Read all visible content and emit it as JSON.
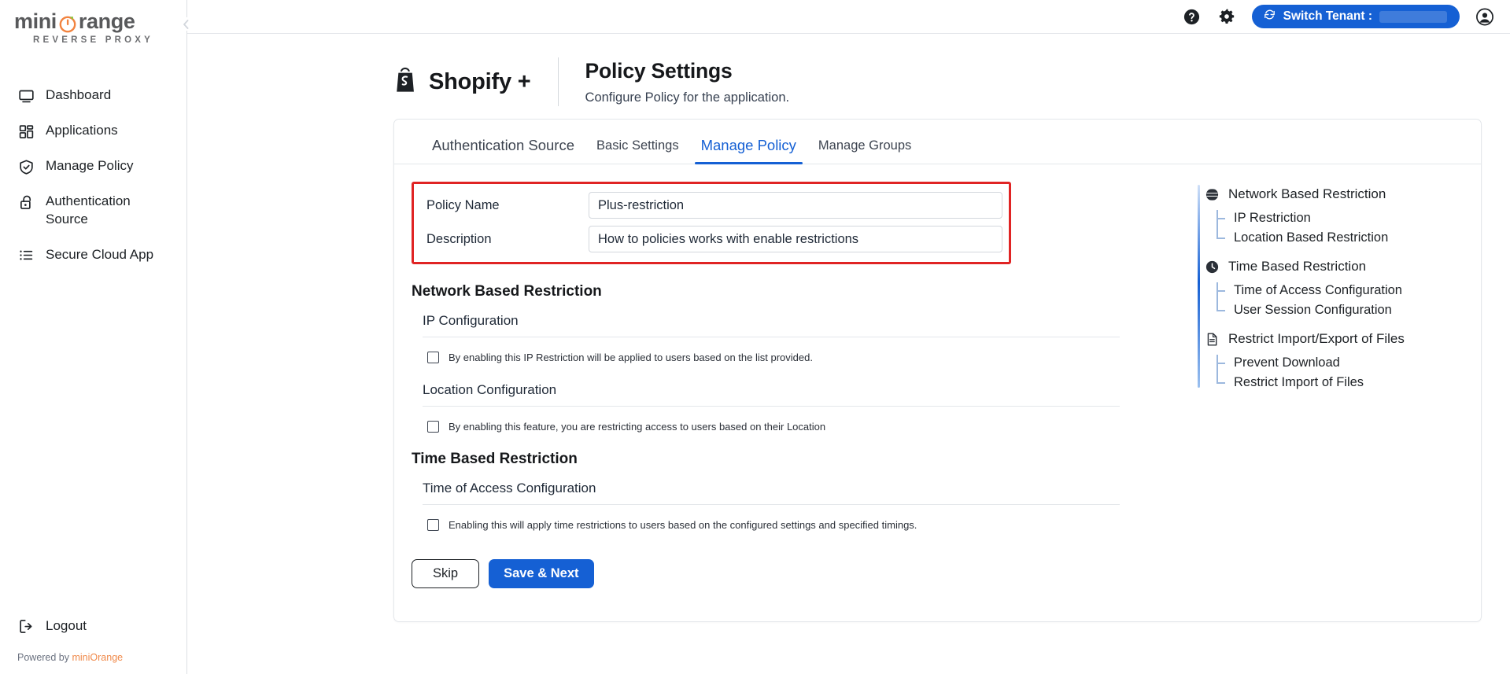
{
  "sidebar": {
    "logo": {
      "text_left": "mini",
      "text_right": "range",
      "subtitle": "REVERSE PROXY"
    },
    "collapse_icon": "chevron-left-icon",
    "items": [
      {
        "label": "Dashboard",
        "icon": "monitor-icon"
      },
      {
        "label": "Applications",
        "icon": "grid-apps-icon"
      },
      {
        "label": "Manage Policy",
        "icon": "shield-check-icon"
      },
      {
        "label": "Authentication Source",
        "icon": "lock-icon"
      },
      {
        "label": "Secure Cloud App",
        "icon": "list-icon"
      }
    ],
    "logout": {
      "label": "Logout",
      "icon": "logout-icon"
    },
    "powered": {
      "prefix": "Powered by ",
      "brand": "miniOrange"
    }
  },
  "topbar": {
    "help_icon": "help-circle-icon",
    "settings_icon": "gear-icon",
    "tenant_button": {
      "label": "Switch Tenant :",
      "icon": "refresh-icon"
    },
    "account_icon": "account-circle-icon"
  },
  "header": {
    "app_icon": "shopify-bag-icon",
    "app_name": "Shopify +",
    "title": "Policy Settings",
    "subtitle": "Configure Policy for the application."
  },
  "tabs": [
    {
      "label": "Authentication Source",
      "active": false
    },
    {
      "label": "Basic Settings",
      "active": false
    },
    {
      "label": "Manage Policy",
      "active": true
    },
    {
      "label": "Manage Groups",
      "active": false
    }
  ],
  "form": {
    "policy_name": {
      "label": "Policy Name",
      "value": "Plus-restriction",
      "placeholder": "Policy Name"
    },
    "description": {
      "label": "Description",
      "value": "How to policies works with enable restrictions",
      "placeholder": "Description"
    },
    "highlight_color": "#e02424"
  },
  "sections": [
    {
      "title": "Network Based Restriction",
      "groups": [
        {
          "sub_title": "IP Configuration",
          "checkbox_label": "By enabling this IP Restriction will be applied to users based on the list provided.",
          "checked": false
        },
        {
          "sub_title": "Location Configuration",
          "checkbox_label": "By enabling this feature, you are restricting access to users based on their Location",
          "checked": false
        }
      ]
    },
    {
      "title": "Time Based Restriction",
      "groups": [
        {
          "sub_title": "Time of Access Configuration",
          "checkbox_label": "Enabling this will apply time restrictions to users based on the configured settings and specified timings.",
          "checked": false
        }
      ]
    }
  ],
  "actions": {
    "skip": "Skip",
    "save": "Save & Next",
    "accent": "#1560d4"
  },
  "outline": [
    {
      "label": "Network Based Restriction",
      "icon": "globe-icon",
      "subs": [
        "IP Restriction",
        "Location Based Restriction"
      ]
    },
    {
      "label": "Time Based Restriction",
      "icon": "clock-icon",
      "subs": [
        "Time of Access Configuration",
        "User Session Configuration"
      ]
    },
    {
      "label": "Restrict Import/Export of Files",
      "icon": "document-icon",
      "subs": [
        "Prevent Download",
        "Restrict Import of Files"
      ]
    }
  ]
}
